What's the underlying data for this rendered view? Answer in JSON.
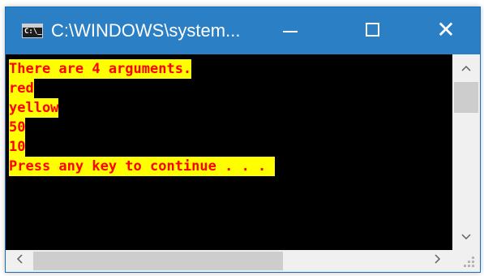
{
  "window": {
    "title": "C:\\WINDOWS\\system...",
    "icon_glyph": "C:\\_",
    "controls": {
      "minimize_icon": "minimize-icon",
      "maximize_icon": "maximize-icon",
      "close_icon": "close-icon"
    }
  },
  "console": {
    "lines": [
      "There are 4 arguments.",
      "red",
      "yellow",
      "50",
      "10",
      "Press any key to continue . . . "
    ],
    "colors": {
      "background": "#000000",
      "text": "#ff0000",
      "text_background": "#ffff00"
    }
  },
  "scrollbars": {
    "vertical": {
      "up_glyph": "^",
      "down_glyph": "v"
    },
    "horizontal": {
      "left_glyph": "<",
      "right_glyph": ">"
    }
  }
}
